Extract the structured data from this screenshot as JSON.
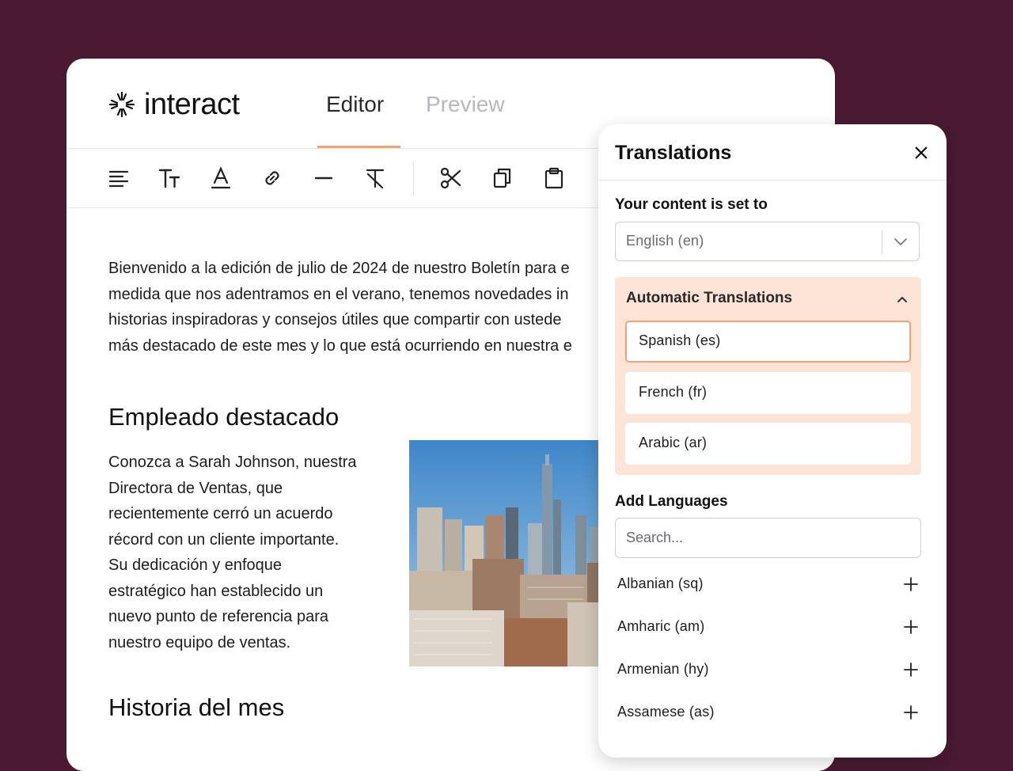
{
  "brand": {
    "name": "interact"
  },
  "tabs": [
    {
      "label": "Editor",
      "active": true
    },
    {
      "label": "Preview",
      "active": false
    }
  ],
  "toolbar": {
    "icons": [
      "align-left-icon",
      "text-size-icon",
      "text-color-icon",
      "link-icon",
      "horizontal-rule-icon",
      "clear-format-icon",
      "cut-icon",
      "copy-icon",
      "paste-icon"
    ]
  },
  "content": {
    "intro_lines": [
      "Bienvenido a la edición de julio de 2024 de nuestro Boletín para e",
      "medida que nos adentramos en el verano, tenemos novedades in",
      "historias inspiradoras y consejos útiles que compartir con ustede",
      "más destacado de este mes y lo que está ocurriendo en nuestra e"
    ],
    "employee_heading": "Empleado destacado",
    "employee_lines": [
      "Conozca a Sarah Johnson, nuestra",
      "Directora de Ventas, que",
      "recientemente cerró un acuerdo",
      "récord con un cliente importante.",
      "Su dedicación y enfoque",
      "estratégico han establecido un",
      "nuevo punto de referencia para",
      "nuestro equipo de ventas."
    ],
    "story_heading": "Historia del mes"
  },
  "translations": {
    "title": "Translations",
    "content_label": "Your content is set to",
    "content_language": "English (en)",
    "automatic_title": "Automatic Translations",
    "automatic_languages": [
      {
        "label": "Spanish (es)",
        "selected": true
      },
      {
        "label": "French (fr)",
        "selected": false
      },
      {
        "label": "Arabic (ar)",
        "selected": false
      }
    ],
    "add_label": "Add Languages",
    "search_placeholder": "Search...",
    "available_languages": [
      "Albanian (sq)",
      "Amharic (am)",
      "Armenian (hy)",
      "Assamese (as)"
    ]
  },
  "colors": {
    "background": "#4a1a33",
    "accent": "#f2a274",
    "auto_box": "#fde4d6"
  }
}
